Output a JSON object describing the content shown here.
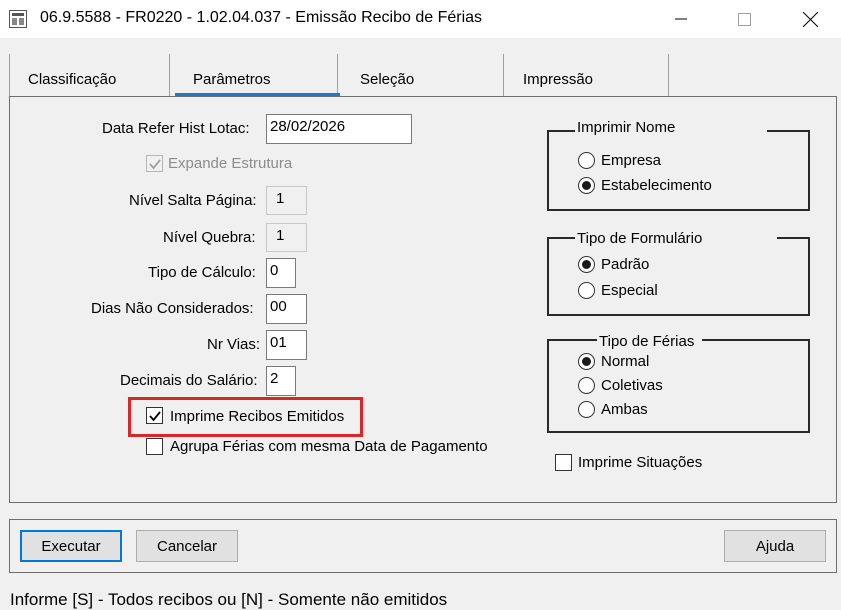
{
  "window": {
    "title": "06.9.5588 - FR0220 - 1.02.04.037 - Emissão Recibo de Férias",
    "controls": [
      "minimize-icon",
      "maximize-icon",
      "close-icon"
    ]
  },
  "tabs": [
    {
      "label": "Classificação",
      "active": false
    },
    {
      "label": "Parâmetros",
      "active": true
    },
    {
      "label": "Seleção",
      "active": false
    },
    {
      "label": "Impressão",
      "active": false
    }
  ],
  "form": {
    "data_refer": {
      "label": "Data Refer Hist Lotac:",
      "value": "28/02/2026"
    },
    "expande_estrutura": {
      "label": "Expande Estrutura",
      "checked": true,
      "enabled": false
    },
    "nivel_salta": {
      "label": "Nível Salta Página:",
      "value": "1"
    },
    "nivel_quebra": {
      "label": "Nível Quebra:",
      "value": "1"
    },
    "tipo_calculo": {
      "label": "Tipo de Cálculo:",
      "value": "0"
    },
    "dias_nao_cons": {
      "label": "Dias Não Considerados:",
      "value": "00"
    },
    "nr_vias": {
      "label": "Nr Vias:",
      "value": "01"
    },
    "decimais": {
      "label": "Decimais do Salário:",
      "value": "2"
    },
    "imprime_recibos": {
      "label": "Imprime Recibos Emitidos",
      "checked": true
    },
    "agrupa_ferias": {
      "label": "Agrupa Férias com mesma Data de Pagamento",
      "checked": false
    }
  },
  "imprimir_nome": {
    "title": "Imprimir Nome",
    "options": [
      {
        "label": "Empresa",
        "selected": false
      },
      {
        "label": "Estabelecimento",
        "selected": true
      }
    ]
  },
  "tipo_formulario": {
    "title": "Tipo de Formulário",
    "options": [
      {
        "label": "Padrão",
        "selected": true
      },
      {
        "label": "Especial",
        "selected": false
      }
    ]
  },
  "tipo_ferias": {
    "title": "Tipo de Férias",
    "options": [
      {
        "label": "Normal",
        "selected": true
      },
      {
        "label": "Coletivas",
        "selected": false
      },
      {
        "label": "Ambas",
        "selected": false
      }
    ]
  },
  "imprime_situacoes": {
    "label": "Imprime Situações",
    "checked": false
  },
  "buttons": {
    "executar": "Executar",
    "cancelar": "Cancelar",
    "ajuda": "Ajuda"
  },
  "status": "Informe [S] - Todos recibos ou [N] - Somente não emitidos",
  "colors": {
    "accent": "#1979ca",
    "highlight": "#d9262c",
    "default_button_border": "#0078d7"
  }
}
